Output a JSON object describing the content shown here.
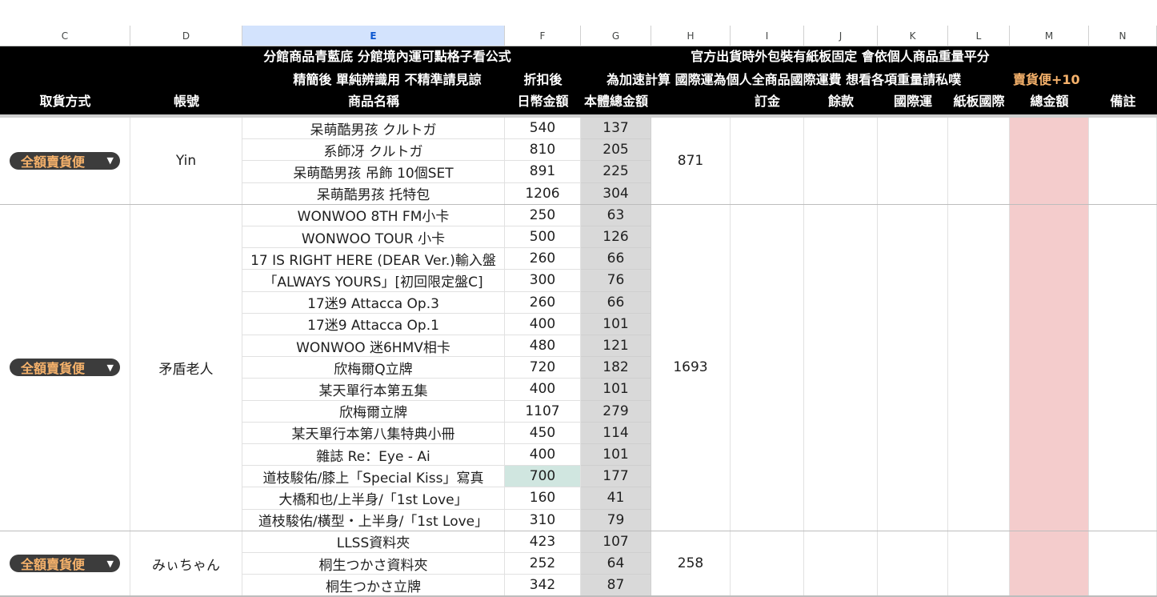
{
  "columns": [
    "C",
    "D",
    "E",
    "F",
    "G",
    "H",
    "I",
    "J",
    "K",
    "L",
    "M",
    "N"
  ],
  "header": {
    "line1_left": "分館商品青藍底 分館境內運可點格子看公式",
    "line1_right": "官方出貨時外包裝有紙板固定 會依個人商品重量平分",
    "line2_e": "精簡後 單純辨識用 不精準請見諒",
    "line2_f": "折扣後",
    "line2_right": "為加速計算 國際運為個人全商品國際運費 想看各項重量請私噗",
    "line2_bonus": "賣貨便+10",
    "line3": [
      "取貨方式",
      "帳號",
      "商品名稱",
      "日幣金額",
      "本體總金額",
      "",
      "訂金",
      "餘款",
      "國際運",
      "紙板國際",
      "總金額",
      "備註"
    ]
  },
  "groups": [
    {
      "shipping": "全額賣貨便",
      "account": "Yin",
      "total": "871",
      "items": [
        {
          "name": "呆萌酷男孩 クルトガ",
          "yen": "540",
          "price": "137"
        },
        {
          "name": "系師冴 クルトガ",
          "yen": "810",
          "price": "205"
        },
        {
          "name": "呆萌酷男孩 吊飾 10個SET",
          "yen": "891",
          "price": "225"
        },
        {
          "name": "呆萌酷男孩 托特包",
          "yen": "1206",
          "price": "304"
        }
      ]
    },
    {
      "shipping": "全額賣貨便",
      "account": "矛盾老人",
      "total": "1693",
      "items": [
        {
          "name": "WONWOO 8TH FM小卡",
          "yen": "250",
          "price": "63"
        },
        {
          "name": "WONWOO TOUR 小卡",
          "yen": "500",
          "price": "126"
        },
        {
          "name": "17 IS RIGHT HERE (DEAR Ver.)輸入盤",
          "yen": "260",
          "price": "66"
        },
        {
          "name": "「ALWAYS YOURS」[初回限定盤C]",
          "yen": "300",
          "price": "76"
        },
        {
          "name": "17迷9 Attacca Op.3",
          "yen": "260",
          "price": "66"
        },
        {
          "name": "17迷9 Attacca Op.1",
          "yen": "400",
          "price": "101"
        },
        {
          "name": "WONWOO 迷6HMV相卡",
          "yen": "480",
          "price": "121"
        },
        {
          "name": "欣梅爾Q立牌",
          "yen": "720",
          "price": "182"
        },
        {
          "name": "某天單行本第五集",
          "yen": "400",
          "price": "101"
        },
        {
          "name": "欣梅爾立牌",
          "yen": "1107",
          "price": "279"
        },
        {
          "name": "某天單行本第八集特典小冊",
          "yen": "450",
          "price": "114"
        },
        {
          "name": "雜誌 Re：Eye - Ai",
          "yen": "400",
          "price": "101"
        },
        {
          "name": "道枝駿佑/膝上「Special Kiss」寫真",
          "yen": "700",
          "price": "177",
          "highlight": true
        },
        {
          "name": "大橋和也/上半身/「1st Love」",
          "yen": "160",
          "price": "41"
        },
        {
          "name": "道枝駿佑/橫型・上半身/「1st Love」",
          "yen": "310",
          "price": "79"
        }
      ]
    },
    {
      "shipping": "全額賣貨便",
      "account": "みぃちゃん",
      "total": "258",
      "items": [
        {
          "name": "LLSS資料夾",
          "yen": "423",
          "price": "107"
        },
        {
          "name": "桐生つかさ資料夾",
          "yen": "252",
          "price": "64"
        },
        {
          "name": "桐生つかさ立牌",
          "yen": "342",
          "price": "87"
        }
      ]
    }
  ],
  "colors": {
    "header_bg": "#000000",
    "accent_orange": "#f6b26b",
    "price_col_bg": "#d9d9d9",
    "total_col_bg": "#f4cccc",
    "highlight_cell": "#d0e6e0",
    "selected_col": "#d3e3fd"
  },
  "icons": {
    "dropdown": "chevron-down-icon"
  }
}
